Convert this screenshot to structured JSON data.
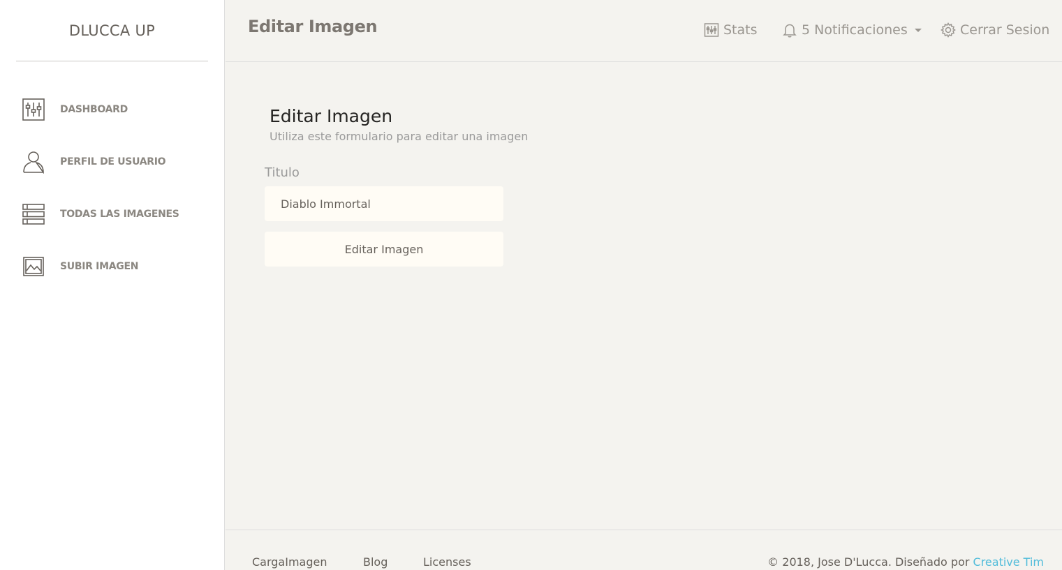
{
  "brand": "DLUCCA UP",
  "sidebar": {
    "items": [
      {
        "label": "DASHBOARD",
        "icon": "sliders-icon"
      },
      {
        "label": "PERFIL DE USUARIO",
        "icon": "user-icon"
      },
      {
        "label": "TODAS LAS IMAGENES",
        "icon": "list-icon"
      },
      {
        "label": "SUBIR IMAGEN",
        "icon": "image-icon"
      }
    ]
  },
  "header": {
    "title": "Editar Imagen",
    "links": {
      "stats": "Stats",
      "notifications": "5 Notificaciones",
      "logout": "Cerrar Sesion"
    }
  },
  "form": {
    "title": "Editar Imagen",
    "subtitle": "Utiliza este formulario para editar una imagen",
    "field_label": "Titulo",
    "field_value": "Diablo Immortal",
    "submit_label": "Editar Imagen"
  },
  "footer": {
    "links": [
      "CargaImagen",
      "Blog",
      "Licenses"
    ],
    "copyright_prefix": "© 2018, Jose D'Lucca. Diseñado por ",
    "copyright_link": "Creative Tim"
  },
  "colors": {
    "background": "#f4f3ef",
    "sidebar": "#ffffff",
    "accent_link": "#51bcda",
    "input_bg": "#fffcf5"
  }
}
